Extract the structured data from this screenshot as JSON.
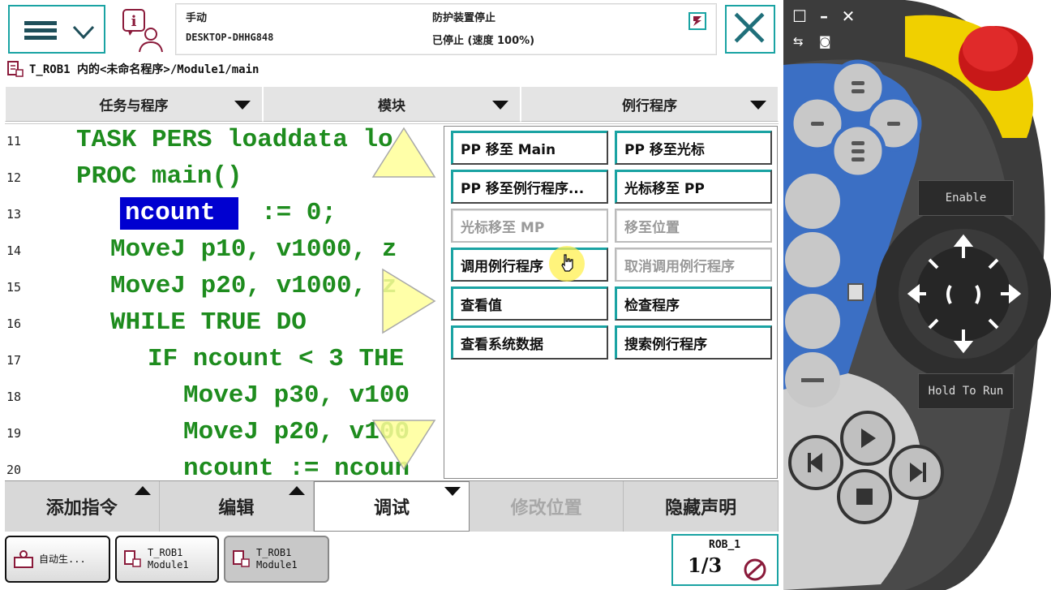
{
  "header": {
    "mode": "手动",
    "system_name": "DESKTOP-DHHG848",
    "guard_status": "防护装置停止",
    "run_status": "已停止 (速度 100%)"
  },
  "breadcrumb": "T_ROB1 内的<未命名程序>/Module1/main",
  "tabs": [
    {
      "label": "任务与程序"
    },
    {
      "label": "模块"
    },
    {
      "label": "例行程序"
    }
  ],
  "code_lines": [
    {
      "num": "11",
      "text": "TASK PERS loaddata lo"
    },
    {
      "num": "12",
      "text": "PROC main()"
    },
    {
      "num": "13",
      "text": ":= 0;",
      "highlight": "ncount"
    },
    {
      "num": "14",
      "text": "MoveJ p10, v1000, z"
    },
    {
      "num": "15",
      "text": "MoveJ p20, v1000, z"
    },
    {
      "num": "16",
      "text": "WHILE TRUE DO"
    },
    {
      "num": "17",
      "text": "IF ncount < 3 THE"
    },
    {
      "num": "18",
      "text": "MoveJ p30, v100"
    },
    {
      "num": "19",
      "text": "MoveJ p20, v100"
    },
    {
      "num": "20",
      "text": "ncount := ncoun"
    }
  ],
  "popup": {
    "items": [
      {
        "label": "PP 移至 Main",
        "enabled": true
      },
      {
        "label": "PP 移至光标",
        "enabled": true
      },
      {
        "label": "PP 移至例行程序...",
        "enabled": true
      },
      {
        "label": "光标移至 PP",
        "enabled": true
      },
      {
        "label": "光标移至 MP",
        "enabled": false
      },
      {
        "label": "移至位置",
        "enabled": false
      },
      {
        "label": "调用例行程序",
        "enabled": true
      },
      {
        "label": "取消调用例行程序",
        "enabled": false
      },
      {
        "label": "查看值",
        "enabled": true
      },
      {
        "label": "检查程序",
        "enabled": true
      },
      {
        "label": "查看系统数据",
        "enabled": true
      },
      {
        "label": "搜索例行程序",
        "enabled": true
      }
    ]
  },
  "command_bar": [
    {
      "label": "添加指令",
      "state": "normal",
      "arrow": "up"
    },
    {
      "label": "编辑",
      "state": "normal",
      "arrow": "up"
    },
    {
      "label": "调试",
      "state": "active",
      "arrow": "down"
    },
    {
      "label": "修改位置",
      "state": "disabled",
      "arrow": ""
    },
    {
      "label": "隐藏声明",
      "state": "normal",
      "arrow": ""
    }
  ],
  "taskbar": {
    "items": [
      {
        "line1": "自动生...",
        "line2": ""
      },
      {
        "line1": "T_ROB1",
        "line2": "Module1"
      },
      {
        "line1": "T_ROB1",
        "line2": "Module1"
      }
    ],
    "robot": {
      "name": "ROB_1",
      "fraction": "1/3"
    }
  },
  "hardware": {
    "enable_label": "Enable",
    "hold_label": "Hold To Run"
  },
  "colors": {
    "accent": "#1aa3a3",
    "code_green": "#1e8c1e",
    "highlight_blue": "#0000d0",
    "estop_red": "#e02020",
    "panel_blue": "#3b6fc4",
    "housing_dark": "#3a3a3a",
    "yellow": "#f0d000"
  }
}
